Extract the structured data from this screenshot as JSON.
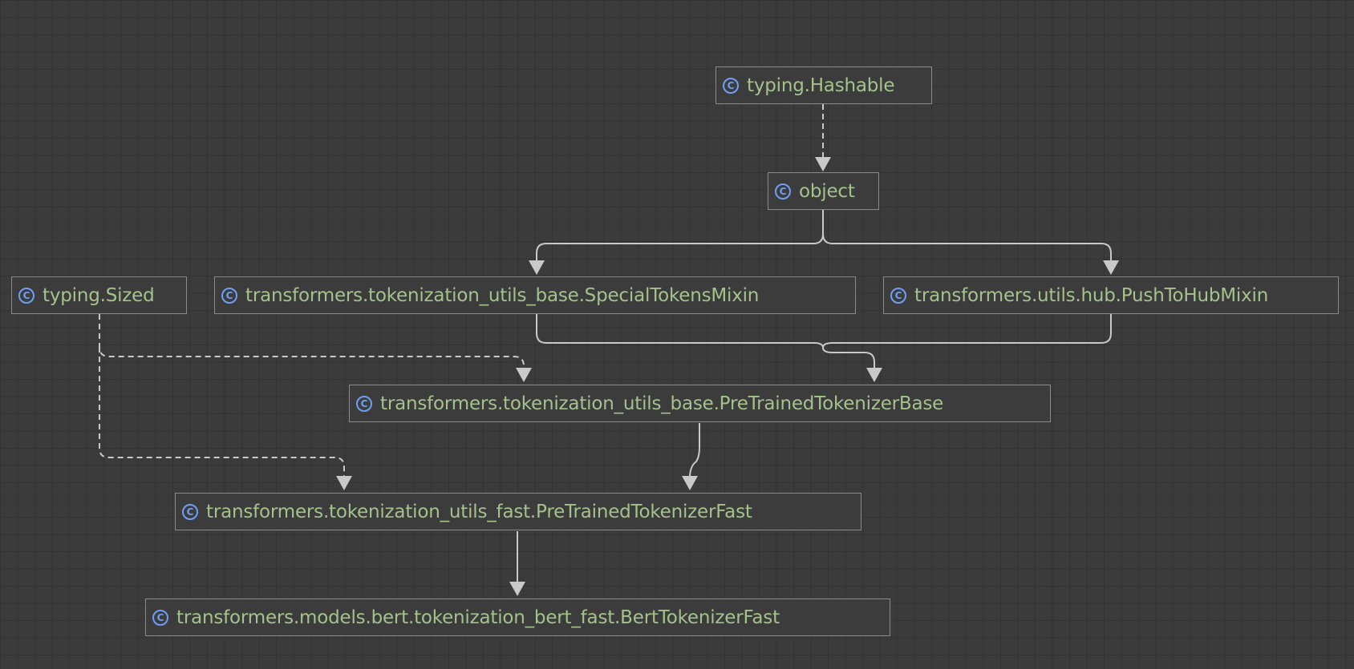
{
  "diagram": {
    "nodes": [
      {
        "id": "hashable",
        "label": "typing.Hashable",
        "icon": "class-icon"
      },
      {
        "id": "object",
        "label": "object",
        "icon": "class-icon"
      },
      {
        "id": "sized",
        "label": "typing.Sized",
        "icon": "class-icon"
      },
      {
        "id": "special",
        "label": "transformers.tokenization_utils_base.SpecialTokensMixin",
        "icon": "class-icon"
      },
      {
        "id": "pushhub",
        "label": "transformers.utils.hub.PushToHubMixin",
        "icon": "class-icon"
      },
      {
        "id": "pretrainedbase",
        "label": "transformers.tokenization_utils_base.PreTrainedTokenizerBase",
        "icon": "class-icon"
      },
      {
        "id": "pretrainedfast",
        "label": "transformers.tokenization_utils_fast.PreTrainedTokenizerFast",
        "icon": "class-icon"
      },
      {
        "id": "bertfast",
        "label": "transformers.models.bert.tokenization_bert_fast.BertTokenizerFast",
        "icon": "class-icon"
      }
    ],
    "icon_glyph": "C",
    "colors": {
      "background": "#3b3b3b",
      "grid": "#333333",
      "node_border": "#8a8a8a",
      "label": "#a5c28d",
      "class_icon": "#6f9ff5",
      "edge": "#c9c9c9"
    },
    "edges": [
      {
        "from": "hashable",
        "to": "object",
        "style": "dashed"
      },
      {
        "from": "object",
        "to": "special",
        "style": "solid"
      },
      {
        "from": "object",
        "to": "pushhub",
        "style": "solid"
      },
      {
        "from": "special",
        "to": "pretrainedbase",
        "style": "solid"
      },
      {
        "from": "pushhub",
        "to": "pretrainedbase",
        "style": "solid"
      },
      {
        "from": "sized",
        "to": "pretrainedbase",
        "style": "dashed"
      },
      {
        "from": "sized",
        "to": "pretrainedfast",
        "style": "dashed"
      },
      {
        "from": "pretrainedbase",
        "to": "pretrainedfast",
        "style": "solid"
      },
      {
        "from": "pretrainedfast",
        "to": "bertfast",
        "style": "solid"
      }
    ]
  }
}
